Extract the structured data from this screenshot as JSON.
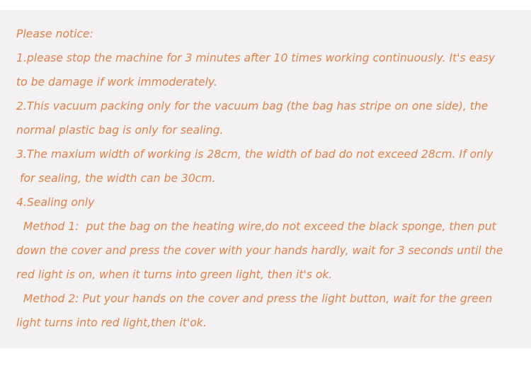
{
  "notice": {
    "lines": [
      "Please notice:",
      "1.please stop the machine for 3 minutes after 10 times working continuously. It's easy",
      "to be damage if work immoderately.",
      "2.This vacuum packing only for the vacuum bag (the bag has stripe on one side), the",
      "normal plastic bag is only for sealing.",
      "3.The maxium width of working is 28cm, the width of bad do not exceed 28cm. If only",
      " for sealing, the width can be 30cm.",
      "4.Sealing only",
      "  Method 1:  put the bag on the heating wire,do not exceed the black sponge, then put",
      "down the cover and press the cover with your hands hardly, wait for 3 seconds until the",
      "red light is on, when it turns into green light, then it's ok.",
      "  Method 2: Put your hands on the cover and press the light button, wait for the green",
      "light turns into red light,then it'ok."
    ],
    "colors": {
      "text": "#e1824b",
      "panel": "#f3f1f2",
      "page": "#ffffff"
    }
  }
}
